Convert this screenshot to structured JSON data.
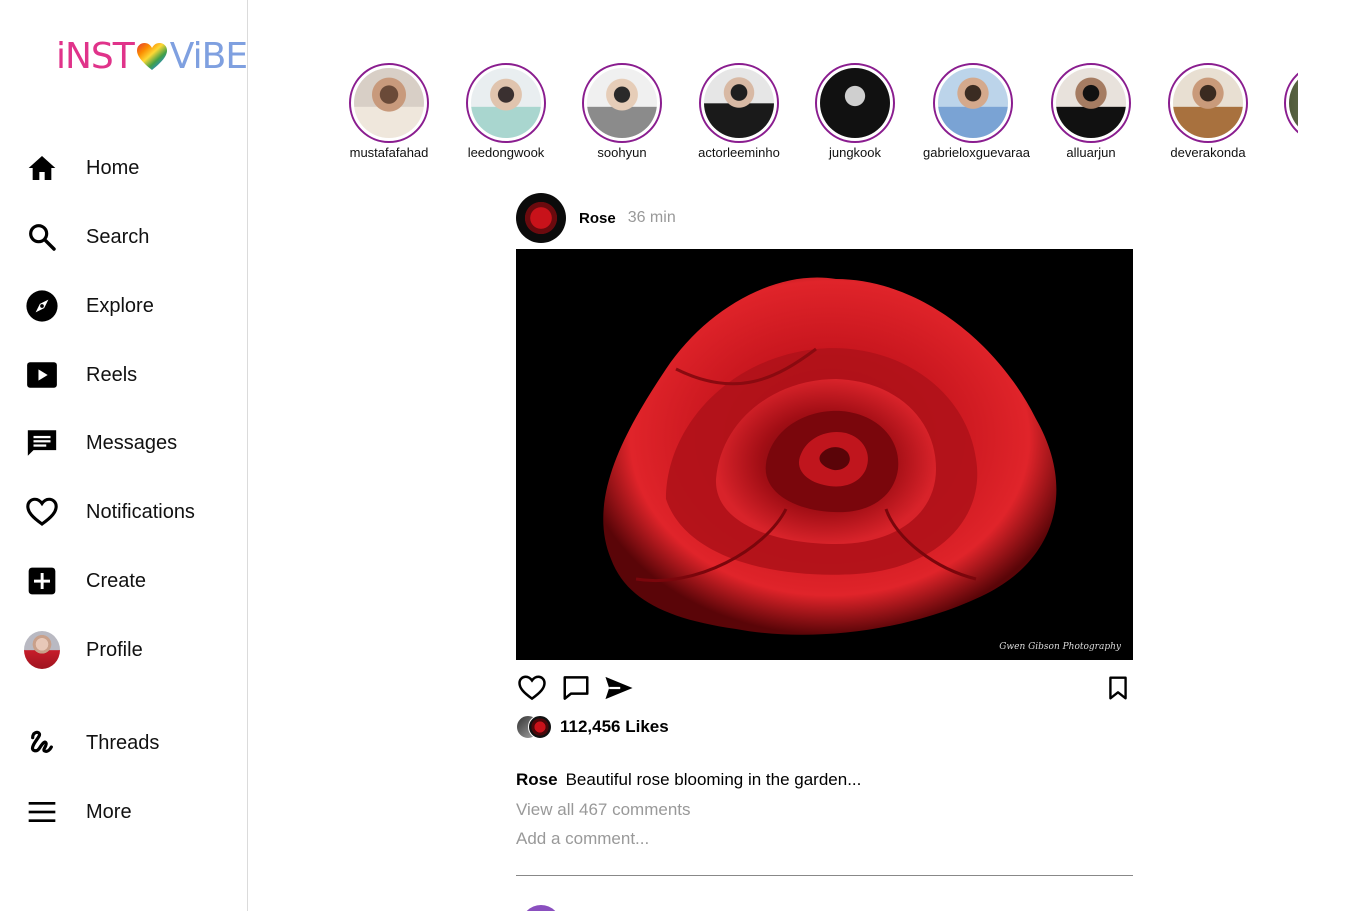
{
  "app": {
    "logo_left": "iNST",
    "logo_right": "ViBE"
  },
  "sidebar": {
    "items": [
      {
        "label": "Home",
        "icon": "home-icon"
      },
      {
        "label": "Search",
        "icon": "search-icon"
      },
      {
        "label": "Explore",
        "icon": "compass-icon"
      },
      {
        "label": "Reels",
        "icon": "reels-icon"
      },
      {
        "label": "Messages",
        "icon": "messages-icon"
      },
      {
        "label": "Notifications",
        "icon": "heart-icon"
      },
      {
        "label": "Create",
        "icon": "plus-square-icon"
      },
      {
        "label": "Profile",
        "icon": "avatar"
      },
      {
        "label": "Threads",
        "icon": "threads-icon"
      },
      {
        "label": "More",
        "icon": "menu-icon"
      }
    ]
  },
  "stories": [
    {
      "username": "mustafafahad"
    },
    {
      "username": "leedongwook"
    },
    {
      "username": "soohyun"
    },
    {
      "username": "actorleeminho"
    },
    {
      "username": "jungkook"
    },
    {
      "username": "gabrieloxguevaraa"
    },
    {
      "username": "alluarjun"
    },
    {
      "username": "deverakonda"
    }
  ],
  "post": {
    "username": "Rose",
    "time": "36 min",
    "watermark": "Gwen Gibson Photography",
    "likes": "112,456 Likes",
    "caption_user": "Rose",
    "caption_text": "Beautiful rose blooming in the garden...",
    "view_comments": "View all 467 comments",
    "add_comment_placeholder": "Add a comment..."
  },
  "colors": {
    "story_ring": "#8a1d8f",
    "logo_pink": "#e0338a",
    "logo_blue": "#7fa0e0",
    "muted_text": "#999999"
  }
}
